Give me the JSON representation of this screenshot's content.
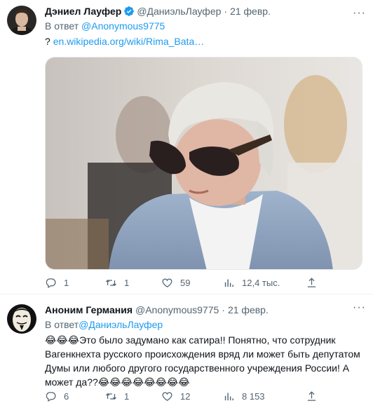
{
  "tweets": [
    {
      "author_name": "Дэниел Лауфер",
      "handle": "@ДаниэльЛауфер",
      "separator": "·",
      "date": "21 февр.",
      "verified": true,
      "reply_prefix": "В ответ",
      "reply_to": "@Anonymous9775",
      "text_prefix": "?",
      "link": "en.wikipedia.org/wiki/Rima_Bata…",
      "actions": {
        "replies": "1",
        "retweets": "1",
        "likes": "59",
        "views": "12,4 тыс."
      }
    },
    {
      "author_name": "Аноним Германия",
      "handle": "@Anonymous9775",
      "separator": "·",
      "date": "21 февр.",
      "reply_prefix": "В ответ",
      "reply_to": "@ДаниэльЛауфер",
      "text": "😂😂😂Это было задумано как сатира!! Понятно, что сотрудник Вагенкнехта русского происхождения вряд ли может быть депутатом Думы или любого другого государственного учреждения России! А может да??😂😂😂😂😂😂😂😂",
      "actions": {
        "replies": "6",
        "retweets": "1",
        "likes": "12",
        "views": "8 153"
      }
    }
  ],
  "more_label": "···",
  "colors": {
    "accent": "#1d9bf0",
    "muted": "#536471",
    "text": "#0f1419",
    "border": "#eff3f4"
  }
}
